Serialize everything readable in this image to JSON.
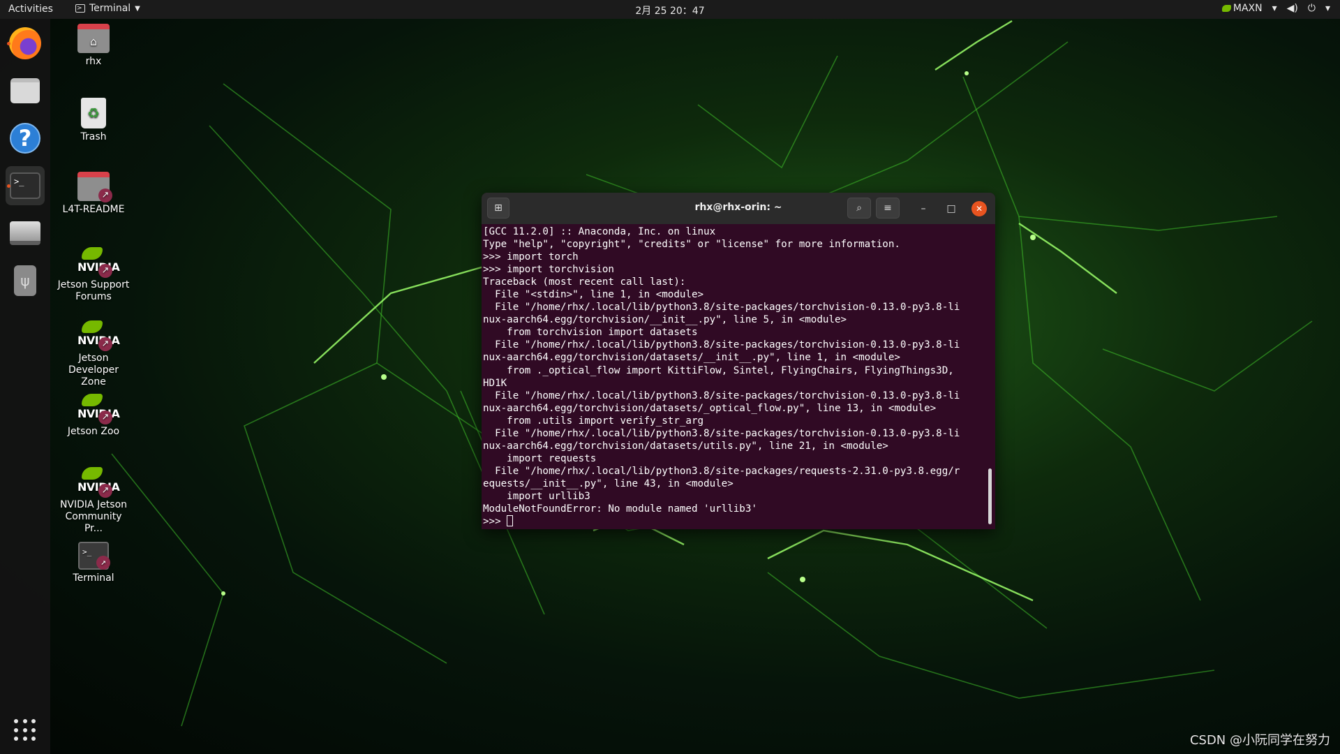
{
  "topbar": {
    "activities": "Activities",
    "app_name": "Terminal",
    "clock": "2月 25 20：47",
    "power_mode": "MAXN"
  },
  "dock": {
    "items": [
      {
        "name": "firefox",
        "icon": "firefox-icon",
        "running": true
      },
      {
        "name": "files",
        "icon": "files-icon",
        "running": false
      },
      {
        "name": "help",
        "icon": "help-icon",
        "running": false
      },
      {
        "name": "terminal",
        "icon": "terminal-icon",
        "running": true,
        "active": true
      },
      {
        "name": "drive",
        "icon": "drive-icon",
        "running": false
      },
      {
        "name": "usb",
        "icon": "usb-icon",
        "running": false
      }
    ],
    "show_apps_icon": "app-grid-icon"
  },
  "desktop": {
    "icons": [
      {
        "label": "rhx",
        "icon": "home-folder-icon"
      },
      {
        "label": "Trash",
        "icon": "trash-icon"
      },
      {
        "label": "L4T-README",
        "icon": "folder-link-icon"
      },
      {
        "label": "Jetson Support Forums",
        "icon": "nvidia-link-icon"
      },
      {
        "label": "Jetson Developer Zone",
        "icon": "nvidia-link-icon"
      },
      {
        "label": "Jetson Zoo",
        "icon": "nvidia-link-icon"
      },
      {
        "label": "NVIDIA Jetson Community Pr...",
        "icon": "nvidia-link-icon"
      },
      {
        "label": "Terminal",
        "icon": "terminal-link-icon"
      }
    ],
    "nvidia_word": "NVIDIA"
  },
  "terminal": {
    "title": "rhx@rhx-orin: ~",
    "lines": [
      "[GCC 11.2.0] :: Anaconda, Inc. on linux",
      "Type \"help\", \"copyright\", \"credits\" or \"license\" for more information.",
      ">>> import torch",
      ">>> import torchvision",
      "Traceback (most recent call last):",
      "  File \"<stdin>\", line 1, in <module>",
      "  File \"/home/rhx/.local/lib/python3.8/site-packages/torchvision-0.13.0-py3.8-li",
      "nux-aarch64.egg/torchvision/__init__.py\", line 5, in <module>",
      "    from torchvision import datasets",
      "  File \"/home/rhx/.local/lib/python3.8/site-packages/torchvision-0.13.0-py3.8-li",
      "nux-aarch64.egg/torchvision/datasets/__init__.py\", line 1, in <module>",
      "    from ._optical_flow import KittiFlow, Sintel, FlyingChairs, FlyingThings3D,",
      "HD1K",
      "  File \"/home/rhx/.local/lib/python3.8/site-packages/torchvision-0.13.0-py3.8-li",
      "nux-aarch64.egg/torchvision/datasets/_optical_flow.py\", line 13, in <module>",
      "    from .utils import verify_str_arg",
      "  File \"/home/rhx/.local/lib/python3.8/site-packages/torchvision-0.13.0-py3.8-li",
      "nux-aarch64.egg/torchvision/datasets/utils.py\", line 21, in <module>",
      "    import requests",
      "  File \"/home/rhx/.local/lib/python3.8/site-packages/requests-2.31.0-py3.8.egg/r",
      "equests/__init__.py\", line 43, in <module>",
      "    import urllib3",
      "ModuleNotFoundError: No module named 'urllib3'"
    ],
    "prompt": ">>> "
  },
  "watermark": "CSDN @小阮同学在努力",
  "colors": {
    "terminal_bg": "#300a24",
    "close_button": "#e95420",
    "nvidia_green": "#76b900"
  }
}
